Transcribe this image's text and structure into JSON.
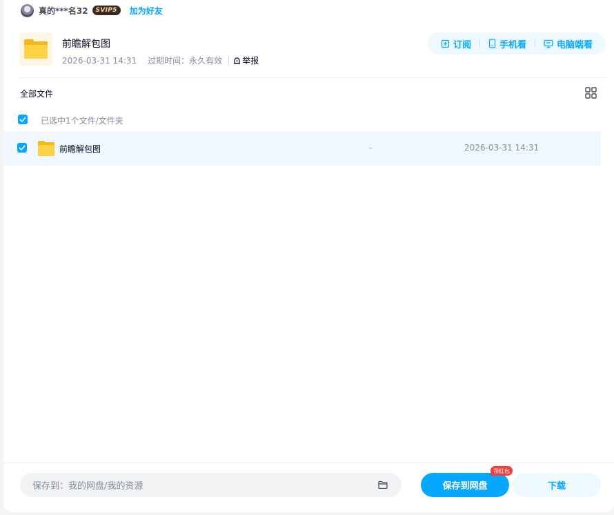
{
  "user": {
    "name": "真的***名32",
    "vip_label": "SVIP5",
    "add_friend_label": "加为好友"
  },
  "file": {
    "title": "前瞻解包图",
    "date": "2026-03-31 14:31",
    "expire_label": "过期时间：",
    "expire_value": "永久有效",
    "report_label": "举报"
  },
  "actions": {
    "subscribe": "订阅",
    "mobile": "手机看",
    "desktop": "电脑端看"
  },
  "list": {
    "breadcrumb": "全部文件",
    "selected_text": "已选中1个文件/文件夹",
    "rows": [
      {
        "name": "前瞻解包图",
        "size": "-",
        "date": "2026-03-31 14:31",
        "checked": true
      }
    ]
  },
  "footer": {
    "save_path_label": "保存到：",
    "save_path_value": "我的网盘/我的资源",
    "save_button": "保存到网盘",
    "badge": "领红包",
    "download_button": "下载"
  },
  "colors": {
    "accent": "#06a7ff",
    "row_highlight": "#f0f7ff",
    "folder_yellow": "#fcd247",
    "badge_red": "#f23d3d"
  },
  "icons": [
    "avatar",
    "folder-icon",
    "report-icon",
    "subscribe-icon",
    "phone-icon",
    "monitor-icon",
    "grid-view-icon",
    "checkbox-icon",
    "folder-picker-icon"
  ]
}
